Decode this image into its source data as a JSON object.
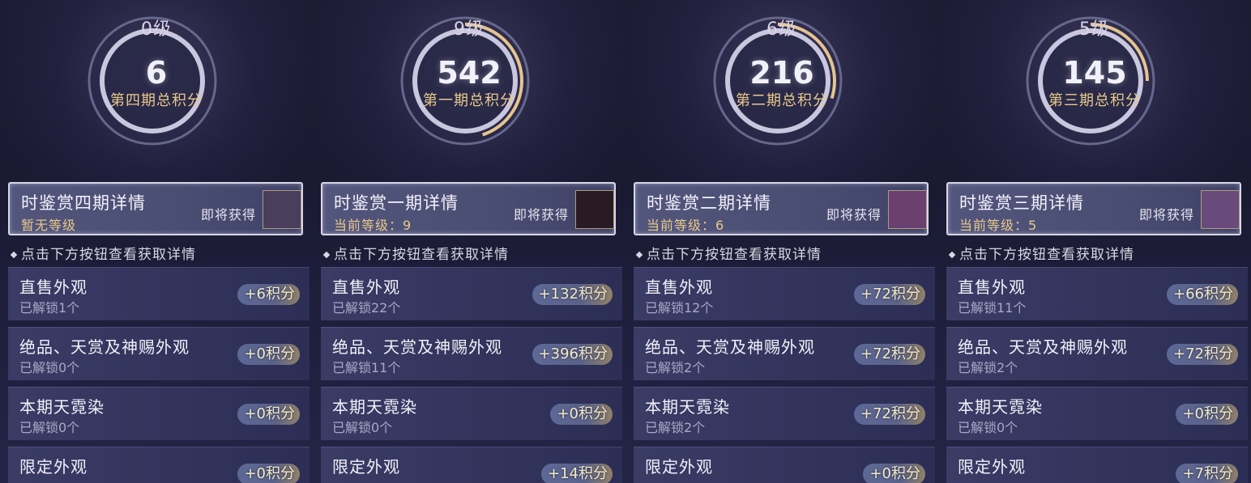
{
  "panels": [
    {
      "level": "9级",
      "score": "542",
      "score_label": "第一期总积分",
      "detail_title": "时鉴赏一期详情",
      "detail_level": "当前等级：9",
      "detail_soon": "即将获得",
      "hint": "点击下方按钮查看获取详情",
      "rows": [
        {
          "title": "直售外观",
          "sub": "已解锁22个",
          "points": "+132积分"
        },
        {
          "title": "绝品、天赏及神赐外观",
          "sub": "已解锁11个",
          "points": "+396积分"
        },
        {
          "title": "本期天霓染",
          "sub": "已解锁0个",
          "points": "+0积分"
        },
        {
          "title": "限定外观",
          "sub": "",
          "points": "+14积分"
        }
      ]
    },
    {
      "level": "6级",
      "score": "216",
      "score_label": "第二期总积分",
      "detail_title": "时鉴赏二期详情",
      "detail_level": "当前等级：6",
      "detail_soon": "即将获得",
      "hint": "点击下方按钮查看获取详情",
      "rows": [
        {
          "title": "直售外观",
          "sub": "已解锁12个",
          "points": "+72积分"
        },
        {
          "title": "绝品、天赏及神赐外观",
          "sub": "已解锁2个",
          "points": "+72积分"
        },
        {
          "title": "本期天霓染",
          "sub": "已解锁2个",
          "points": "+72积分"
        },
        {
          "title": "限定外观",
          "sub": "",
          "points": "+0积分"
        }
      ]
    },
    {
      "level": "5级",
      "score": "145",
      "score_label": "第三期总积分",
      "detail_title": "时鉴赏三期详情",
      "detail_level": "当前等级：5",
      "detail_soon": "即将获得",
      "hint": "点击下方按钮查看获取详情",
      "rows": [
        {
          "title": "直售外观",
          "sub": "已解锁11个",
          "points": "+66积分"
        },
        {
          "title": "绝品、天赏及神赐外观",
          "sub": "已解锁2个",
          "points": "+72积分"
        },
        {
          "title": "本期天霓染",
          "sub": "已解锁0个",
          "points": "+0积分"
        },
        {
          "title": "限定外观",
          "sub": "",
          "points": "+7积分"
        }
      ]
    },
    {
      "level": "0级",
      "score": "6",
      "score_label": "第四期总积分",
      "detail_title": "时鉴赏四期详情",
      "detail_level": "暂无等级",
      "detail_soon": "即将获得",
      "hint": "点击下方按钮查看获取详情",
      "rows": [
        {
          "title": "直售外观",
          "sub": "已解锁1个",
          "points": "+6积分"
        },
        {
          "title": "绝品、天赏及神赐外观",
          "sub": "已解锁0个",
          "points": "+0积分"
        },
        {
          "title": "本期天霓染",
          "sub": "已解锁0个",
          "points": "+0积分"
        },
        {
          "title": "限定外观",
          "sub": "",
          "points": "+0积分"
        }
      ]
    }
  ],
  "progress": [
    0.9,
    0.6,
    0.5,
    0.0
  ],
  "thumb_colors": [
    "#2a1a22",
    "#6b3f6e",
    "#6a4a7a",
    "#4a3e5c"
  ]
}
